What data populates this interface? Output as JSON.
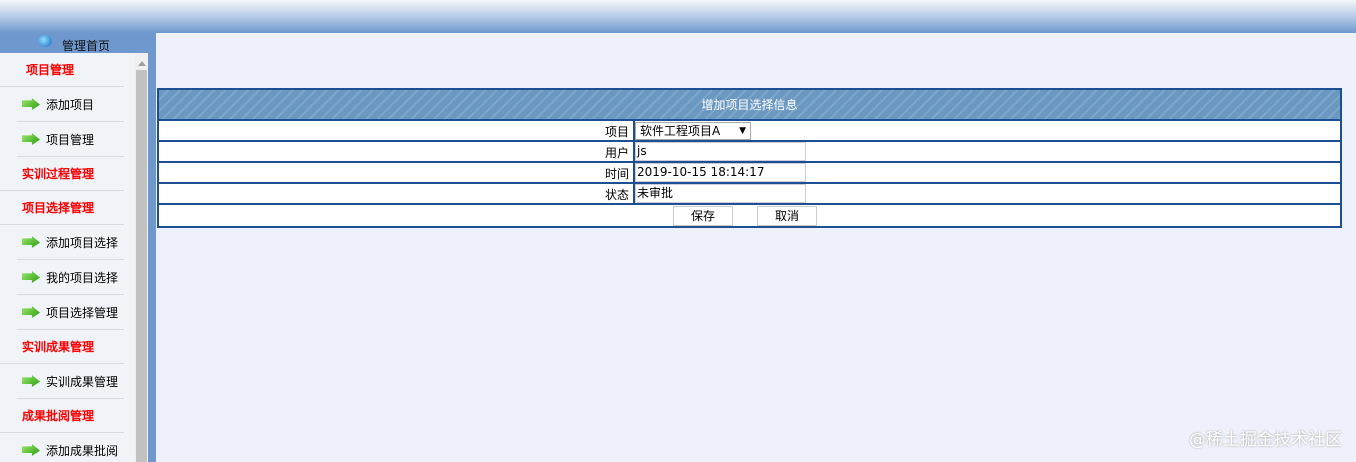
{
  "nav": {
    "home": "管理首页",
    "items": [
      {
        "label": "项目管理",
        "type": "category"
      },
      {
        "label": "添加项目",
        "type": "link"
      },
      {
        "label": "项目管理",
        "type": "link"
      },
      {
        "label": "实训过程管理",
        "type": "category"
      },
      {
        "label": "项目选择管理",
        "type": "category"
      },
      {
        "label": "添加项目选择",
        "type": "link"
      },
      {
        "label": "我的项目选择",
        "type": "link"
      },
      {
        "label": "项目选择管理",
        "type": "link"
      },
      {
        "label": "实训成果管理",
        "type": "category"
      },
      {
        "label": "实训成果管理",
        "type": "link"
      },
      {
        "label": "成果批阅管理",
        "type": "category"
      },
      {
        "label": "添加成果批阅",
        "type": "link"
      }
    ]
  },
  "form": {
    "title": "增加项目选择信息",
    "project_label": "项目",
    "project_value": "软件工程项目A",
    "user_label": "用户",
    "user_value": "js",
    "time_label": "时间",
    "time_value": "2019-10-15 18:14:17",
    "status_label": "状态",
    "status_value": "未审批",
    "save": "保存",
    "cancel": "取消"
  },
  "watermark": "@稀土掘金技术社区"
}
